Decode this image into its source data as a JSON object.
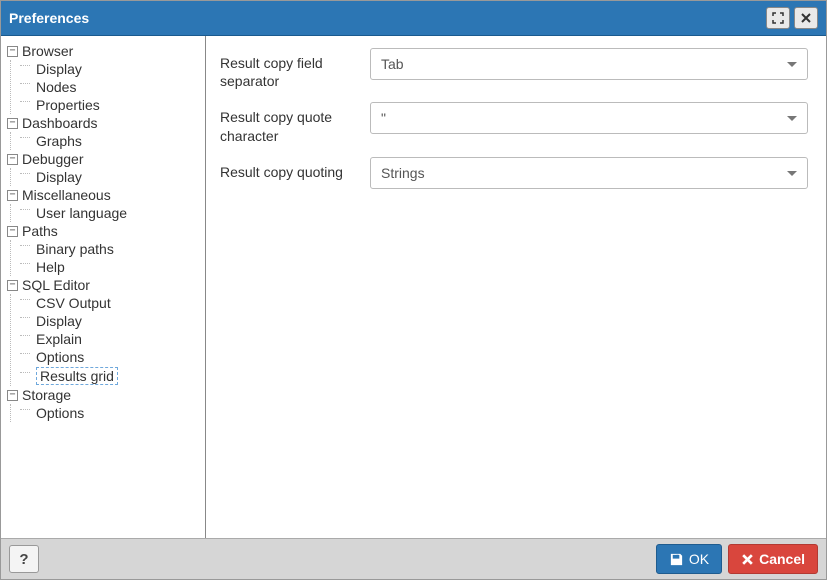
{
  "title": "Preferences",
  "tree": {
    "browser": {
      "label": "Browser",
      "children": {
        "display": "Display",
        "nodes": "Nodes",
        "properties": "Properties"
      }
    },
    "dashboards": {
      "label": "Dashboards",
      "children": {
        "graphs": "Graphs"
      }
    },
    "debugger": {
      "label": "Debugger",
      "children": {
        "display": "Display"
      }
    },
    "misc": {
      "label": "Miscellaneous",
      "children": {
        "userlang": "User language"
      }
    },
    "paths": {
      "label": "Paths",
      "children": {
        "binary": "Binary paths",
        "help": "Help"
      }
    },
    "sqleditor": {
      "label": "SQL Editor",
      "children": {
        "csv": "CSV Output",
        "display": "Display",
        "explain": "Explain",
        "options": "Options",
        "results": "Results grid"
      }
    },
    "storage": {
      "label": "Storage",
      "children": {
        "options": "Options"
      }
    }
  },
  "form": {
    "sep_label": "Result copy field separator",
    "sep_value": "Tab",
    "quote_label": "Result copy quote character",
    "quote_value": "\"",
    "quoting_label": "Result copy quoting",
    "quoting_value": "Strings"
  },
  "buttons": {
    "help": "?",
    "ok": "OK",
    "cancel": "Cancel"
  }
}
